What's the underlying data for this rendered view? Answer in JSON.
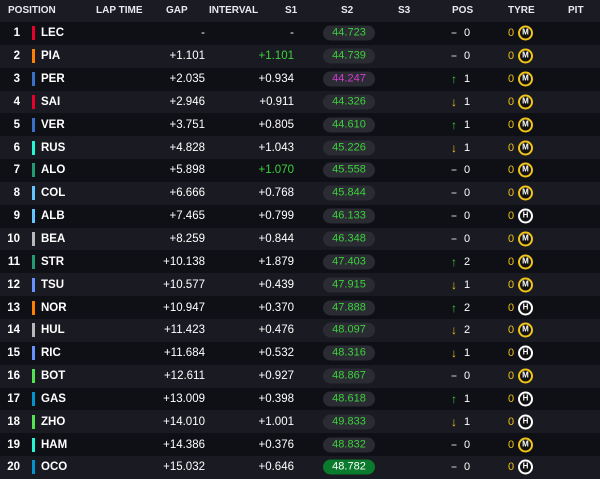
{
  "headers": {
    "position": "POSITION",
    "lap_time": "LAP TIME",
    "gap": "GAP",
    "interval": "INTERVAL",
    "s1": "S1",
    "s2": "S2",
    "s3": "S3",
    "pos": "POS",
    "tyre": "TYRE",
    "pit": "PIT"
  },
  "colors": {
    "sector_green": "#3cd23c",
    "sector_purple": "#d23cd2",
    "sector_fill": "#0a7a2c",
    "arrow_up": "#3cd23c",
    "arrow_down": "#f0c419",
    "medium_tyre": "#f0c419",
    "hard_tyre": "#ffffff"
  },
  "rows": [
    {
      "pos": "1",
      "team_color": "#e8002d",
      "driver": "LEC",
      "gap": "-",
      "interval": "-",
      "interval_green": false,
      "s2": "44.723",
      "s2_style": "green",
      "arrow": "–",
      "arrow_dir": "same",
      "pos_change": "0",
      "tyre_count": "0",
      "tyre_compound": "medium",
      "tyre_letter": "M"
    },
    {
      "pos": "2",
      "team_color": "#ff8000",
      "driver": "PIA",
      "gap": "+1.101",
      "interval": "+1.101",
      "interval_green": true,
      "s2": "44.739",
      "s2_style": "green",
      "arrow": "–",
      "arrow_dir": "same",
      "pos_change": "0",
      "tyre_count": "0",
      "tyre_compound": "medium",
      "tyre_letter": "M"
    },
    {
      "pos": "3",
      "team_color": "#3671c6",
      "driver": "PER",
      "gap": "+2.035",
      "interval": "+0.934",
      "interval_green": false,
      "s2": "44.247",
      "s2_style": "purple",
      "arrow": "↑",
      "arrow_dir": "up",
      "pos_change": "1",
      "tyre_count": "0",
      "tyre_compound": "medium",
      "tyre_letter": "M"
    },
    {
      "pos": "4",
      "team_color": "#e8002d",
      "driver": "SAI",
      "gap": "+2.946",
      "interval": "+0.911",
      "interval_green": false,
      "s2": "44.326",
      "s2_style": "green",
      "arrow": "↓",
      "arrow_dir": "down",
      "pos_change": "1",
      "tyre_count": "0",
      "tyre_compound": "medium",
      "tyre_letter": "M"
    },
    {
      "pos": "5",
      "team_color": "#3671c6",
      "driver": "VER",
      "gap": "+3.751",
      "interval": "+0.805",
      "interval_green": false,
      "s2": "44.610",
      "s2_style": "green",
      "arrow": "↑",
      "arrow_dir": "up",
      "pos_change": "1",
      "tyre_count": "0",
      "tyre_compound": "medium",
      "tyre_letter": "M"
    },
    {
      "pos": "6",
      "team_color": "#27f4d2",
      "driver": "RUS",
      "gap": "+4.828",
      "interval": "+1.043",
      "interval_green": false,
      "s2": "45.226",
      "s2_style": "green",
      "arrow": "↓",
      "arrow_dir": "down",
      "pos_change": "1",
      "tyre_count": "0",
      "tyre_compound": "medium",
      "tyre_letter": "M"
    },
    {
      "pos": "7",
      "team_color": "#229971",
      "driver": "ALO",
      "gap": "+5.898",
      "interval": "+1.070",
      "interval_green": true,
      "s2": "45.558",
      "s2_style": "green",
      "arrow": "–",
      "arrow_dir": "same",
      "pos_change": "0",
      "tyre_count": "0",
      "tyre_compound": "medium",
      "tyre_letter": "M"
    },
    {
      "pos": "8",
      "team_color": "#64c4ff",
      "driver": "COL",
      "gap": "+6.666",
      "interval": "+0.768",
      "interval_green": false,
      "s2": "45.844",
      "s2_style": "green",
      "arrow": "–",
      "arrow_dir": "same",
      "pos_change": "0",
      "tyre_count": "0",
      "tyre_compound": "medium",
      "tyre_letter": "M"
    },
    {
      "pos": "9",
      "team_color": "#64c4ff",
      "driver": "ALB",
      "gap": "+7.465",
      "interval": "+0.799",
      "interval_green": false,
      "s2": "46.133",
      "s2_style": "green",
      "arrow": "–",
      "arrow_dir": "same",
      "pos_change": "0",
      "tyre_count": "0",
      "tyre_compound": "hard",
      "tyre_letter": "H"
    },
    {
      "pos": "10",
      "team_color": "#b6babd",
      "driver": "BEA",
      "gap": "+8.259",
      "interval": "+0.844",
      "interval_green": false,
      "s2": "46.348",
      "s2_style": "green",
      "arrow": "–",
      "arrow_dir": "same",
      "pos_change": "0",
      "tyre_count": "0",
      "tyre_compound": "medium",
      "tyre_letter": "M"
    },
    {
      "pos": "11",
      "team_color": "#229971",
      "driver": "STR",
      "gap": "+10.138",
      "interval": "+1.879",
      "interval_green": false,
      "s2": "47.403",
      "s2_style": "green",
      "arrow": "↑",
      "arrow_dir": "up",
      "pos_change": "2",
      "tyre_count": "0",
      "tyre_compound": "medium",
      "tyre_letter": "M"
    },
    {
      "pos": "12",
      "team_color": "#6692ff",
      "driver": "TSU",
      "gap": "+10.577",
      "interval": "+0.439",
      "interval_green": false,
      "s2": "47.915",
      "s2_style": "green",
      "arrow": "↓",
      "arrow_dir": "down",
      "pos_change": "1",
      "tyre_count": "0",
      "tyre_compound": "medium",
      "tyre_letter": "M"
    },
    {
      "pos": "13",
      "team_color": "#ff8000",
      "driver": "NOR",
      "gap": "+10.947",
      "interval": "+0.370",
      "interval_green": false,
      "s2": "47.888",
      "s2_style": "green",
      "arrow": "↑",
      "arrow_dir": "up",
      "pos_change": "2",
      "tyre_count": "0",
      "tyre_compound": "hard",
      "tyre_letter": "H"
    },
    {
      "pos": "14",
      "team_color": "#b6babd",
      "driver": "HUL",
      "gap": "+11.423",
      "interval": "+0.476",
      "interval_green": false,
      "s2": "48.097",
      "s2_style": "green",
      "arrow": "↓",
      "arrow_dir": "down",
      "pos_change": "2",
      "tyre_count": "0",
      "tyre_compound": "medium",
      "tyre_letter": "M"
    },
    {
      "pos": "15",
      "team_color": "#6692ff",
      "driver": "RIC",
      "gap": "+11.684",
      "interval": "+0.532",
      "interval_green": false,
      "s2": "48.316",
      "s2_style": "green",
      "arrow": "↓",
      "arrow_dir": "down",
      "pos_change": "1",
      "tyre_count": "0",
      "tyre_compound": "hard",
      "tyre_letter": "H"
    },
    {
      "pos": "16",
      "team_color": "#52e252",
      "driver": "BOT",
      "gap": "+12.611",
      "interval": "+0.927",
      "interval_green": false,
      "s2": "48.867",
      "s2_style": "green",
      "arrow": "–",
      "arrow_dir": "same",
      "pos_change": "0",
      "tyre_count": "0",
      "tyre_compound": "medium",
      "tyre_letter": "M"
    },
    {
      "pos": "17",
      "team_color": "#0093cc",
      "driver": "GAS",
      "gap": "+13.009",
      "interval": "+0.398",
      "interval_green": false,
      "s2": "48.618",
      "s2_style": "green",
      "arrow": "↑",
      "arrow_dir": "up",
      "pos_change": "1",
      "tyre_count": "0",
      "tyre_compound": "hard",
      "tyre_letter": "H"
    },
    {
      "pos": "18",
      "team_color": "#52e252",
      "driver": "ZHO",
      "gap": "+14.010",
      "interval": "+1.001",
      "interval_green": false,
      "s2": "49.833",
      "s2_style": "green",
      "arrow": "↓",
      "arrow_dir": "down",
      "pos_change": "1",
      "tyre_count": "0",
      "tyre_compound": "hard",
      "tyre_letter": "H"
    },
    {
      "pos": "19",
      "team_color": "#27f4d2",
      "driver": "HAM",
      "gap": "+14.386",
      "interval": "+0.376",
      "interval_green": false,
      "s2": "48.832",
      "s2_style": "green",
      "arrow": "–",
      "arrow_dir": "same",
      "pos_change": "0",
      "tyre_count": "0",
      "tyre_compound": "medium",
      "tyre_letter": "M"
    },
    {
      "pos": "20",
      "team_color": "#0093cc",
      "driver": "OCO",
      "gap": "+15.032",
      "interval": "+0.646",
      "interval_green": false,
      "s2": "48.782",
      "s2_style": "fill",
      "arrow": "–",
      "arrow_dir": "same",
      "pos_change": "0",
      "tyre_count": "0",
      "tyre_compound": "hard",
      "tyre_letter": "H"
    }
  ]
}
